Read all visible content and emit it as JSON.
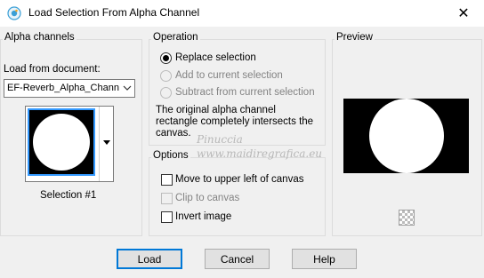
{
  "window": {
    "title": "Load Selection From Alpha Channel",
    "close_glyph": "✕"
  },
  "alpha": {
    "group_title": "Alpha channels",
    "load_label": "Load from document:",
    "document_value": "EF-Reverb_Alpha_Chann",
    "selection_label": "Selection #1"
  },
  "operation": {
    "group_title": "Operation",
    "options": [
      {
        "label": "Replace selection",
        "checked": true,
        "enabled": true
      },
      {
        "label": "Add to current selection",
        "checked": false,
        "enabled": false
      },
      {
        "label": "Subtract from current selection",
        "checked": false,
        "enabled": false
      }
    ],
    "info_line1": "The original alpha channel",
    "info_line2": "rectangle completely intersects the",
    "info_line3": "canvas."
  },
  "options": {
    "group_title": "Options",
    "items": [
      {
        "label": "Move to upper left of canvas",
        "checked": false,
        "enabled": true
      },
      {
        "label": "Clip to canvas",
        "checked": false,
        "enabled": false
      },
      {
        "label": "Invert image",
        "checked": false,
        "enabled": true
      }
    ]
  },
  "preview": {
    "group_title": "Preview"
  },
  "buttons": {
    "load": "Load",
    "cancel": "Cancel",
    "help": "Help"
  },
  "watermark": {
    "name": "Pinuccia",
    "url": "www.maidiregrafica.eu"
  }
}
